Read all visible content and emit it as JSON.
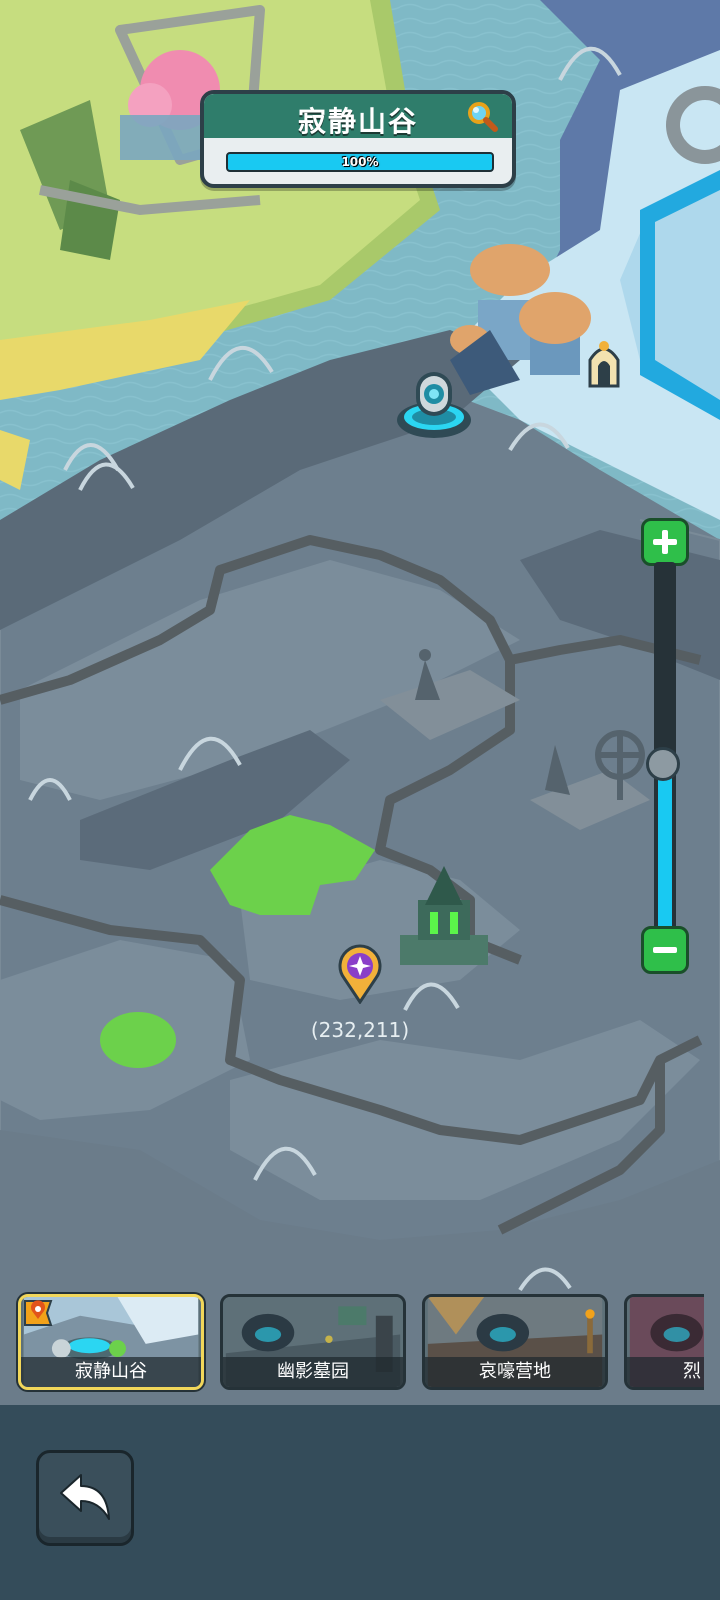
{
  "region_card": {
    "name": "寂静山谷",
    "progress_percent": 100,
    "progress_label": "100%",
    "search_icon": "magnifier-icon"
  },
  "zoom": {
    "plus_icon": "plus-icon",
    "minus_icon": "minus-icon",
    "level_fraction": 0.45
  },
  "player": {
    "coordinates": "(232,211)",
    "pin_icon": "location-pin-star-icon"
  },
  "regions": [
    {
      "label": "寂静山谷",
      "active": true,
      "badge_icon": "current-location-flag-icon"
    },
    {
      "label": "幽影墓园",
      "active": false
    },
    {
      "label": "哀嚎营地",
      "active": false
    },
    {
      "label": "烈",
      "active": false
    }
  ],
  "back_button": {
    "icon": "back-arrow-icon"
  },
  "colors": {
    "accent_cyan": "#19c9f2",
    "zoom_green": "#2fbf4a",
    "header_green": "#2f7d6b",
    "active_border": "#f2d75a"
  }
}
